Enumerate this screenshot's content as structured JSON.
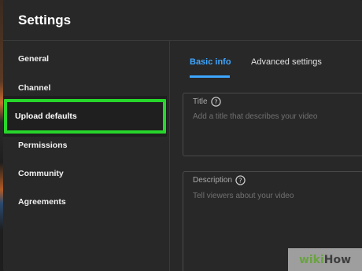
{
  "header": {
    "title": "Settings"
  },
  "sidebar": {
    "items": [
      {
        "label": "General"
      },
      {
        "label": "Channel"
      },
      {
        "label": "Upload defaults"
      },
      {
        "label": "Permissions"
      },
      {
        "label": "Community"
      },
      {
        "label": "Agreements"
      }
    ]
  },
  "tabs": [
    {
      "label": "Basic info",
      "active": true
    },
    {
      "label": "Advanced settings",
      "active": false
    }
  ],
  "fields": {
    "title": {
      "label": "Title",
      "placeholder": "Add a title that describes your video"
    },
    "description": {
      "label": "Description",
      "placeholder": "Tell viewers about your video"
    }
  },
  "watermark": {
    "part1": "wiki",
    "part2": "How"
  },
  "colors": {
    "accent": "#3ea6ff",
    "highlight": "#27d62b",
    "background": "#282828"
  },
  "icons": {
    "help": "help-circle-icon"
  }
}
